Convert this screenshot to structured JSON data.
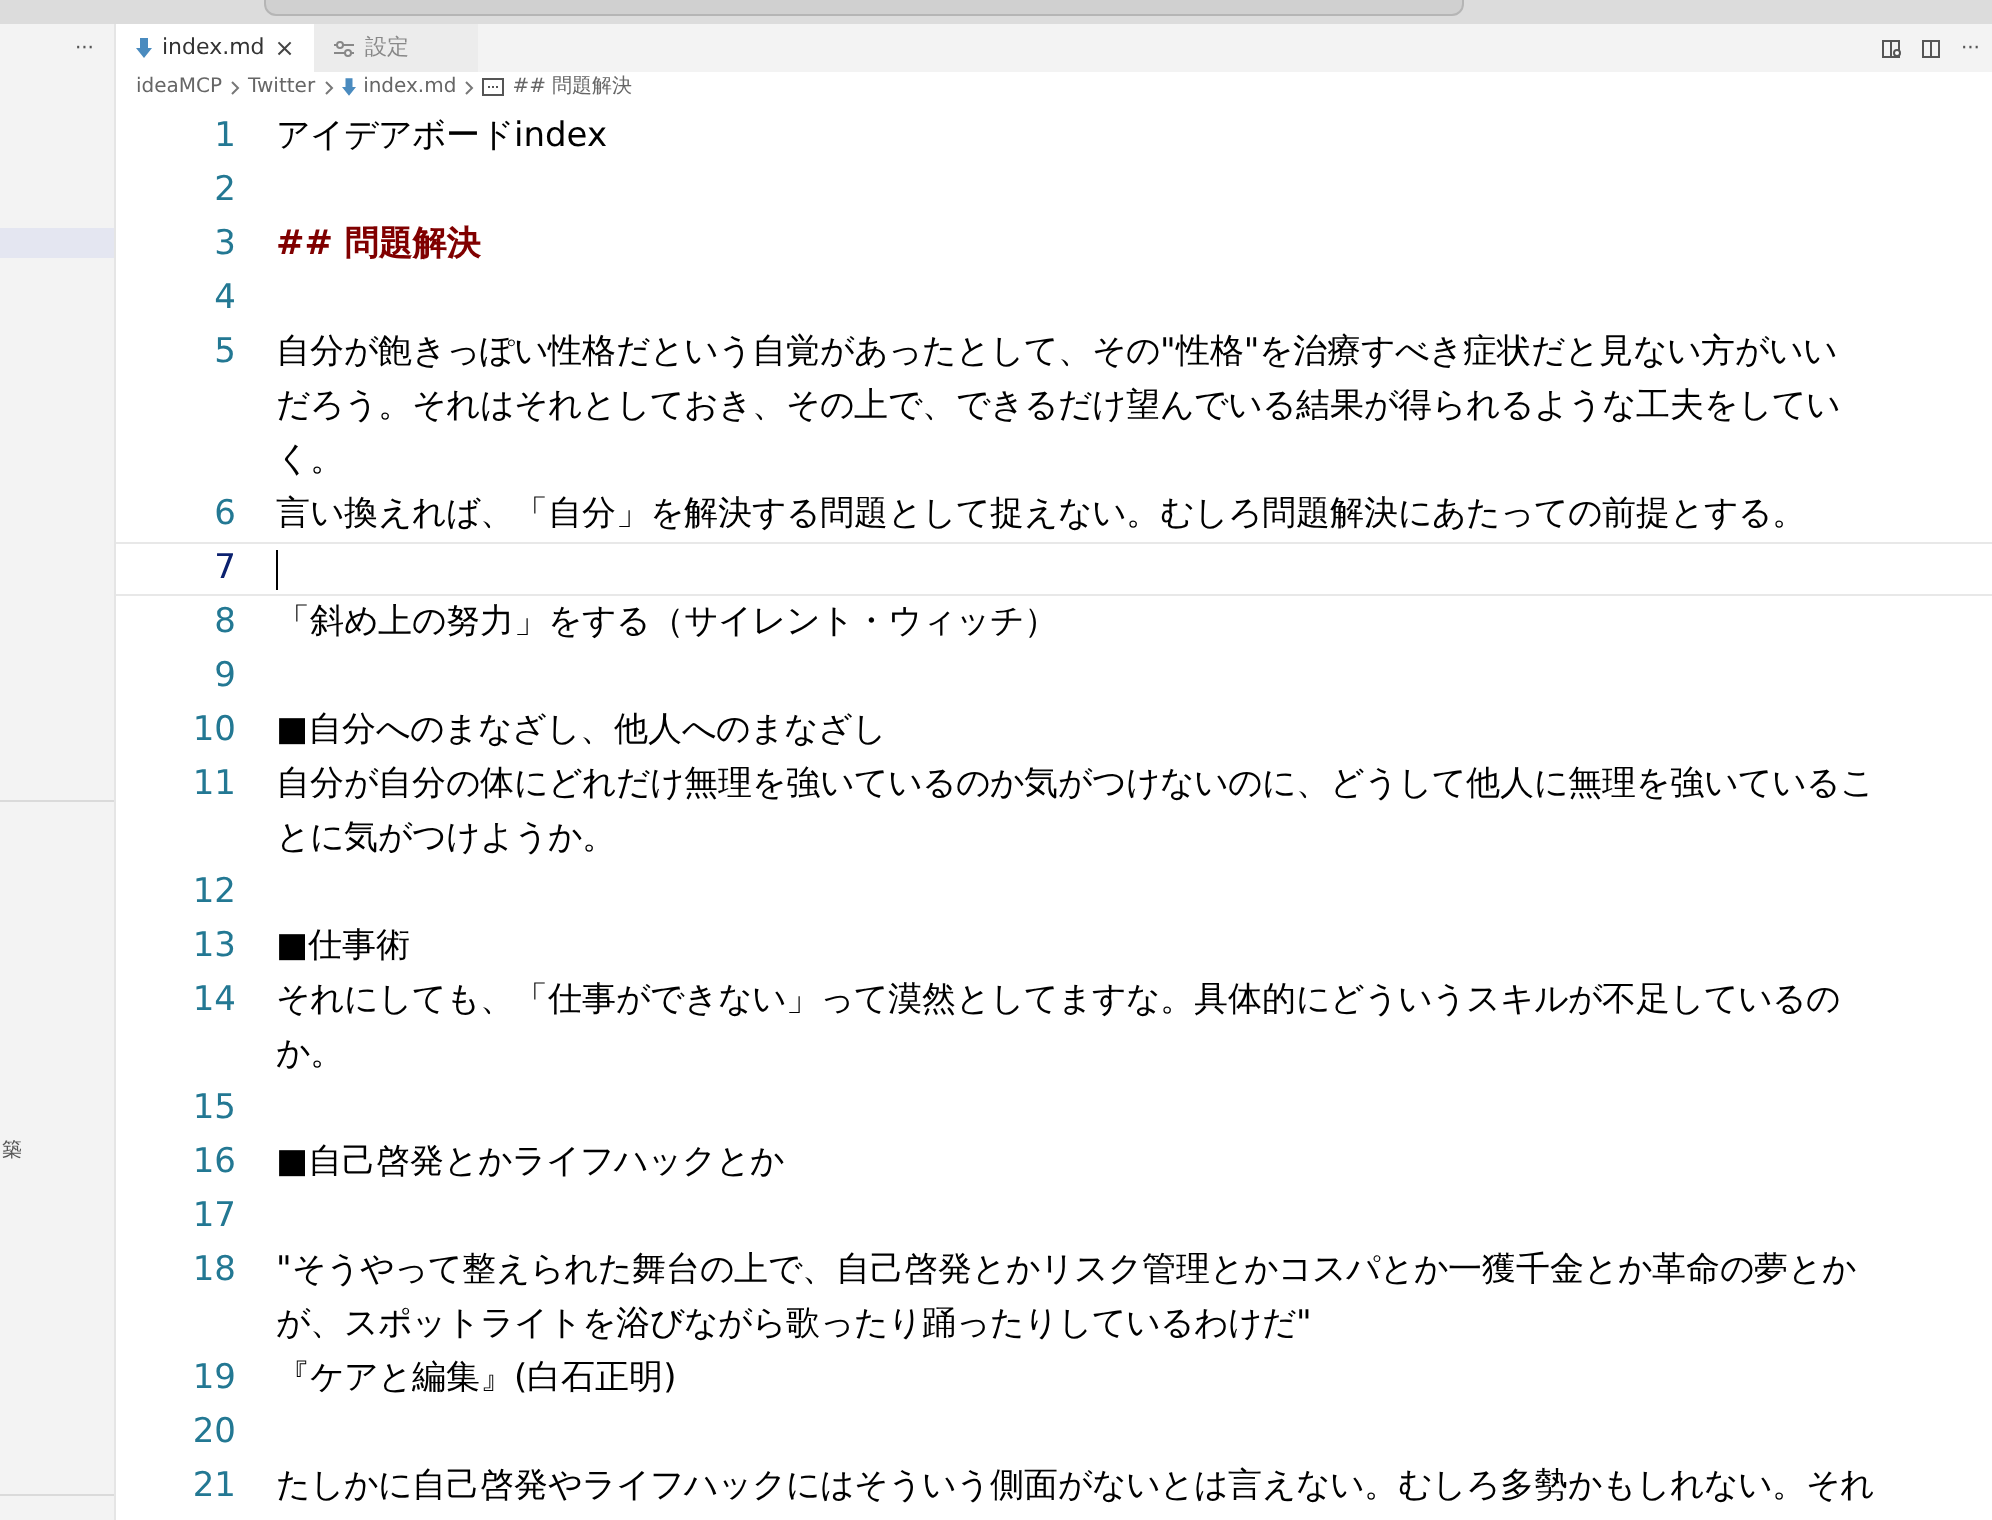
{
  "sidebar": {
    "more": "···",
    "items": [
      {
        "label": "築",
        "selected": false
      }
    ],
    "highlight": true
  },
  "tabs": [
    {
      "label": "index.md",
      "kind": "markdown",
      "selected": true,
      "close": "×"
    },
    {
      "label": "設定",
      "kind": "settings",
      "selected": false
    }
  ],
  "toolbar": {
    "more": "···"
  },
  "breadcrumb": [
    {
      "label": "ideaMCP",
      "kind": "folder"
    },
    {
      "label": "Twitter",
      "kind": "folder"
    },
    {
      "label": "index.md",
      "kind": "markdown"
    },
    {
      "label": "## 問題解決",
      "kind": "symbol"
    }
  ],
  "lines": [
    {
      "number": "1",
      "kind": "text",
      "current": false,
      "rows": [
        "アイデアボードindex"
      ]
    },
    {
      "number": "2",
      "kind": "blank",
      "current": false
    },
    {
      "number": "3",
      "kind": "heading",
      "current": false,
      "rows": [
        "## 問題解決"
      ]
    },
    {
      "number": "4",
      "kind": "blank",
      "current": false
    },
    {
      "number": "5",
      "kind": "text",
      "current": false,
      "rows": [
        "自分が飽きっぽい性格だという自覚があったとして、その\"性格\"を治療すべき症状だと見ない方がいい",
        "だろう。それはそれとしておき、その上で、できるだけ望んでいる結果が得られるような工夫をしてい",
        "く。"
      ]
    },
    {
      "number": "6",
      "kind": "text",
      "current": false,
      "rows": [
        "言い換えれば、「自分」を解決する問題として捉えない。むしろ問題解決にあたっての前提とする。"
      ]
    },
    {
      "number": "7",
      "kind": "blank",
      "current": true
    },
    {
      "number": "8",
      "kind": "text",
      "current": false,
      "rows": [
        "「斜め上の努力」をする（サイレント・ウィッチ）"
      ]
    },
    {
      "number": "9",
      "kind": "blank",
      "current": false
    },
    {
      "number": "10",
      "kind": "text",
      "current": false,
      "rows": [
        "■自分へのまなざし、他人へのまなざし"
      ]
    },
    {
      "number": "11",
      "kind": "text",
      "current": false,
      "rows": [
        "自分が自分の体にどれだけ無理を強いているのか気がつけないのに、どうして他人に無理を強いているこ",
        "とに気がつけようか。"
      ]
    },
    {
      "number": "12",
      "kind": "blank",
      "current": false
    },
    {
      "number": "13",
      "kind": "text",
      "current": false,
      "rows": [
        "■仕事術"
      ]
    },
    {
      "number": "14",
      "kind": "text",
      "current": false,
      "rows": [
        "それにしても、「仕事ができない」って漠然としてますな。具体的にどういうスキルが不足しているの",
        "か。"
      ]
    },
    {
      "number": "15",
      "kind": "blank",
      "current": false
    },
    {
      "number": "16",
      "kind": "text",
      "current": false,
      "rows": [
        "■自己啓発とかライフハックとか"
      ]
    },
    {
      "number": "17",
      "kind": "blank",
      "current": false
    },
    {
      "number": "18",
      "kind": "text",
      "current": false,
      "rows": [
        "\"そうやって整えられた舞台の上で、自己啓発とかリスク管理とかコスパとか一獲千金とか革命の夢とか",
        "が、スポットライトを浴びながら歌ったり踊ったりしているわけだ\""
      ]
    },
    {
      "number": "19",
      "kind": "text",
      "current": false,
      "rows": [
        "『ケアと編集』(白石正明)"
      ]
    },
    {
      "number": "20",
      "kind": "blank",
      "current": false
    },
    {
      "number": "21",
      "kind": "text",
      "current": false,
      "rows": [
        "たしかに自己啓発やライフハックにはそういう側面がないとは言えない。むしろ多勢かもしれない。それ"
      ]
    }
  ]
}
